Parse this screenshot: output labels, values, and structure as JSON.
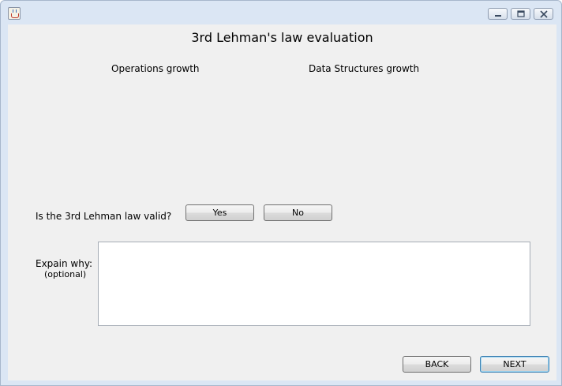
{
  "window": {
    "icons": {
      "app": "java-cup-icon",
      "minimize": "minimize-icon",
      "maximize": "maximize-icon",
      "close": "close-icon"
    }
  },
  "main": {
    "title": "3rd Lehman's law evaluation",
    "operations_label": "Operations growth",
    "data_structures_label": "Data Structures growth",
    "question": "Is the 3rd Lehman law valid?",
    "yes_label": "Yes",
    "no_label": "No",
    "explain_label": "Expain why:",
    "optional_label": "(optional)",
    "explain_value": ""
  },
  "footer": {
    "back_label": "BACK",
    "next_label": "NEXT"
  },
  "colors": {
    "panel": "#f0f0f0",
    "titlebar": "#dbe6f4",
    "focus_border": "#3c7fb1"
  }
}
